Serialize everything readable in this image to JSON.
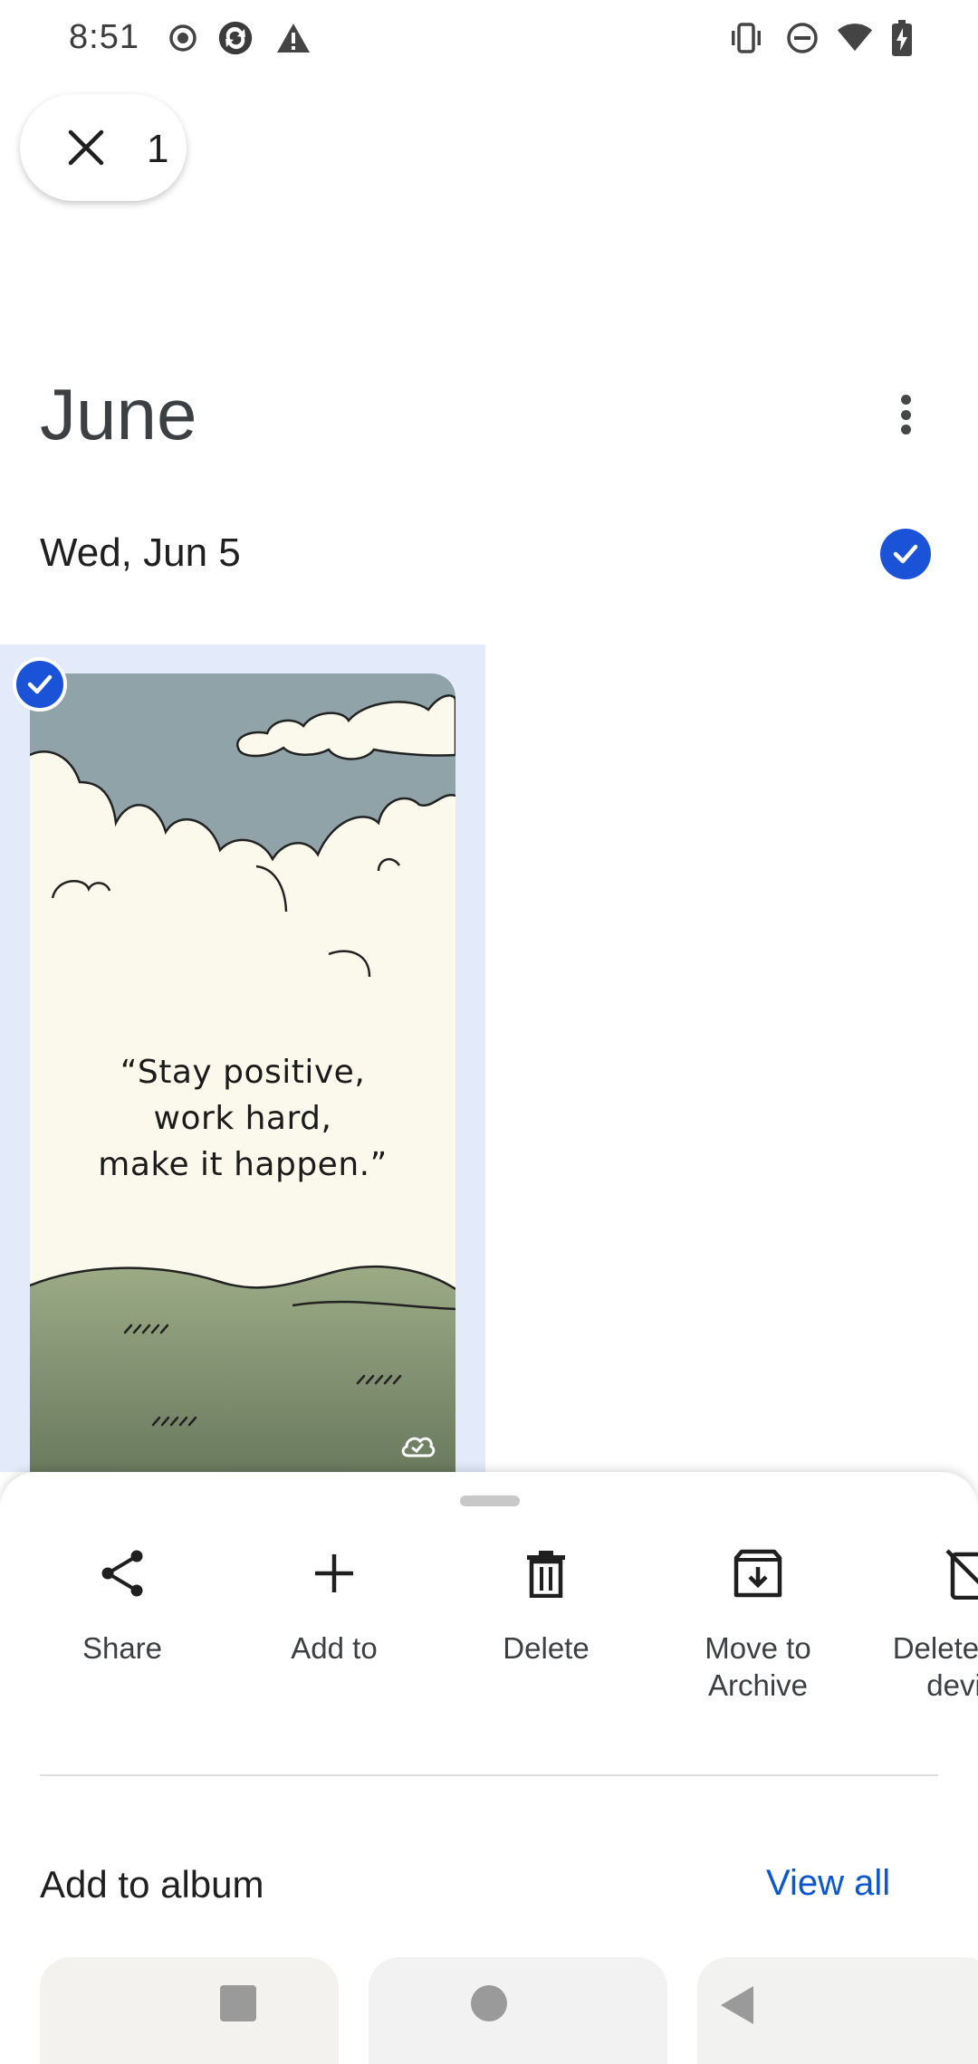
{
  "status_bar": {
    "time": "8:51",
    "left_icons": [
      "screen-record-icon",
      "sync-app-icon",
      "warning-icon"
    ],
    "right_icons": [
      "vibrate-icon",
      "do-not-disturb-icon",
      "wifi-icon",
      "battery-charging-icon"
    ]
  },
  "selection": {
    "count": "1",
    "close_icon": "close-icon"
  },
  "header": {
    "month": "June",
    "more_icon": "more-vertical-icon"
  },
  "date_group": {
    "label": "Wed, Jun 5",
    "selected": true
  },
  "photo": {
    "selected": true,
    "quote_lines": [
      "“Stay positive,",
      "work hard,",
      "make it happen.”"
    ],
    "cloud_icon": "cloud-done-icon"
  },
  "actions": [
    {
      "icon": "share-icon",
      "label": "Share"
    },
    {
      "icon": "add-icon",
      "label": "Add to"
    },
    {
      "icon": "trash-icon",
      "label": "Delete"
    },
    {
      "icon": "archive-icon",
      "label": "Move to Archive"
    },
    {
      "icon": "delete-from-device-icon",
      "label": "Delete from device"
    }
  ],
  "album_section": {
    "title": "Add to album",
    "view_all": "View all"
  },
  "nav_bar": {
    "icons": [
      "recents-icon",
      "home-icon",
      "back-icon"
    ]
  },
  "colors": {
    "accent_blue": "#1a53d8",
    "link_blue": "#0b57d0",
    "selected_tile_bg": "#e3ebfb",
    "sky": "#8fa3a9",
    "hills": "#8a9c78"
  }
}
